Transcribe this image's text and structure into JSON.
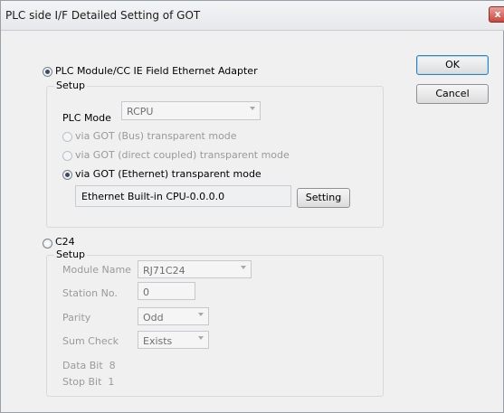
{
  "window": {
    "title": "PLC side I/F Detailed Setting of GOT",
    "close_glyph": "x"
  },
  "buttons": {
    "ok": "OK",
    "cancel": "Cancel"
  },
  "plc_module": {
    "option_label": "PLC Module/CC IE Field Ethernet Adapter",
    "selected": true,
    "setup_legend": "Setup",
    "plc_mode_label": "PLC Mode",
    "plc_mode_value": "RCPU",
    "modes": [
      {
        "label": "via GOT (Bus) transparent mode",
        "selected": false,
        "enabled": false
      },
      {
        "label": "via GOT (direct coupled) transparent mode",
        "selected": false,
        "enabled": false
      },
      {
        "label": "via GOT (Ethernet) transparent mode",
        "selected": true,
        "enabled": true
      }
    ],
    "ethernet_target": "Ethernet Built-in CPU-0.0.0.0",
    "setting_button": "Setting"
  },
  "c24": {
    "option_label": "C24",
    "selected": false,
    "setup_legend": "Setup",
    "module_name_label": "Module Name",
    "module_name_value": "RJ71C24",
    "station_no_label": "Station No.",
    "station_no_value": "0",
    "parity_label": "Parity",
    "parity_value": "Odd",
    "sum_check_label": "Sum Check",
    "sum_check_value": "Exists",
    "data_bit_text": "Data Bit  8",
    "stop_bit_text": "Stop Bit  1"
  }
}
